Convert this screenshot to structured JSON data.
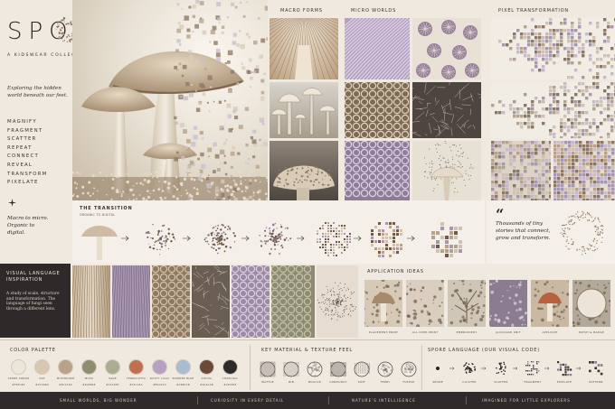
{
  "brand": {
    "title": "SPORE",
    "subtitle": "A KIDSWEAR COLLECTION",
    "intro": "Exploring the hidden world beneath our feet.",
    "keywords": [
      "MAGNIFY",
      "FRAGMENT",
      "SCATTER",
      "REPEAT",
      "CONNECT",
      "REVEAL",
      "TRANSFORM",
      "PIXELATE"
    ],
    "macro_text": "Macro to micro. Organic to digital."
  },
  "sections": {
    "macro_forms": "MACRO FORMS",
    "micro_worlds": "MICRO WORLDS",
    "pixel_transformation": "PIXEL TRANSFORMATION",
    "transition_title": "THE TRANSITION",
    "transition_sub": "ORGANIC TO DIGITAL",
    "visual_language": "VISUAL LANGUAGE INSPIRATION",
    "visual_language_text": "A study of scale, structure and transformation. The language of fungi seen through a different lens.",
    "application_ideas": "APPLICATION IDEAS",
    "color_palette": "COLOR PALETTE",
    "material_feel": "KEY MATERIAL & TEXTURE FEEL",
    "spore_language": "SPORE LANGUAGE (OUR VISUAL CODE)"
  },
  "quote": {
    "mark": "“",
    "text": "Thousands of tiny stories that connect, grow and transform."
  },
  "applications": [
    "PLACEMENT PRINT",
    "ALL OVER PRINT",
    "EMBROIDERY",
    "JACQUARD KNIT",
    "APPLIQUE",
    "PATCH & BADGE"
  ],
  "palette": [
    {
      "name": "SPORE CREAM",
      "hex": "#F2EDE4",
      "color": "#ece5da"
    },
    {
      "name": "OAT",
      "hex": "#D7C6B0",
      "color": "#d8c8b1"
    },
    {
      "name": "MUSHROOM",
      "hex": "#B7A189",
      "color": "#b9a288"
    },
    {
      "name": "MOSS",
      "hex": "#8A8B6E",
      "color": "#8d8d70"
    },
    {
      "name": "SAGE",
      "hex": "#A7AD8F",
      "color": "#aaad92"
    },
    {
      "name": "TERRACOTTA",
      "hex": "#C47A5A",
      "color": "#c0704f"
    },
    {
      "name": "DUSTY LILAC",
      "hex": "#B9A3C3",
      "color": "#b7a0c4"
    },
    {
      "name": "POWDER BLUE",
      "hex": "#A9BCCB",
      "color": "#a8bdd0"
    },
    {
      "name": "COCOA",
      "hex": "#6A4A3B",
      "color": "#6b4a3a"
    },
    {
      "name": "CHARCOAL",
      "hex": "#2E2E2E",
      "color": "#2c2a2a"
    }
  ],
  "materials": [
    "WAFFLE",
    "RIB",
    "BOUCLE",
    "CORDUROY",
    "KNIT",
    "TERRY",
    "FLEECE"
  ],
  "spore_codes": [
    "SPORE",
    "CLUSTER",
    "SCATTER",
    "FRAGMENT",
    "PIXELATE",
    "PATTERN"
  ],
  "footer": [
    "SMALL WORLDS, BIG WONDER",
    "CURIOSITY IN EVERY DETAIL",
    "NATURE'S INTELLIGENCE",
    "IMAGINED FOR LITTLE EXPLORERS"
  ],
  "colors": {
    "bg": "#efe9df",
    "dark": "#2b2622",
    "lilac": "#8b7a98",
    "tan": "#c9b79e"
  }
}
